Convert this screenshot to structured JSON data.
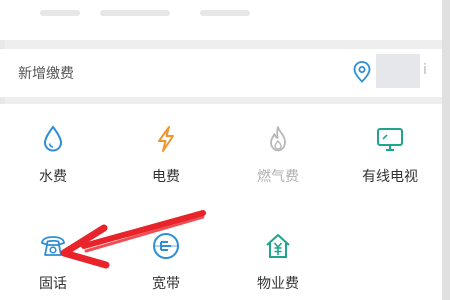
{
  "add_payment": {
    "title": "新增缴费"
  },
  "services": [
    {
      "label": "水费",
      "icon": "water-drop-icon",
      "color": "#2f8fd6"
    },
    {
      "label": "电费",
      "icon": "lightning-icon",
      "color": "#f0962e"
    },
    {
      "label": "燃气费",
      "icon": "flame-icon",
      "color": "#b0b0b0"
    },
    {
      "label": "有线电视",
      "icon": "tv-icon",
      "color": "#1ea68a"
    },
    {
      "label": "固话",
      "icon": "telephone-icon",
      "color": "#2f8fd6"
    },
    {
      "label": "宽带",
      "icon": "broadband-icon",
      "color": "#2f8fd6"
    },
    {
      "label": "物业费",
      "icon": "property-fee-icon",
      "color": "#1ea68a"
    }
  ],
  "annotation_color": "#e8232a"
}
